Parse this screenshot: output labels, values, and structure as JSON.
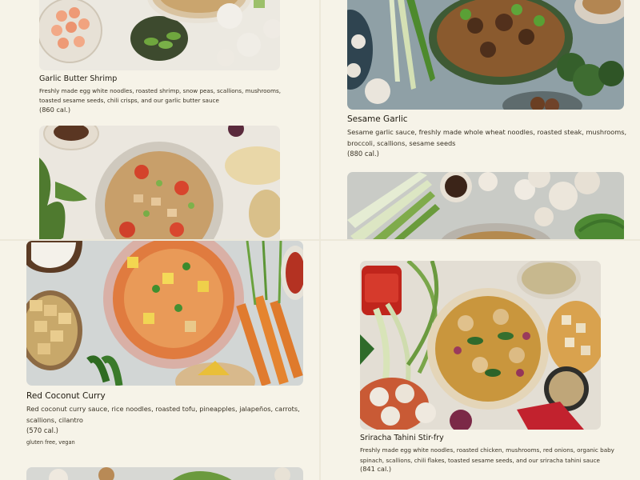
{
  "menu": {
    "items": [
      {
        "name": "Garlic Butter Shrimp",
        "description": "Freshly made egg white noodles, roasted shrimp, snow peas, scallions, mushrooms, toasted sesame seeds, chili crisps, and our garlic butter sauce",
        "calories": "(860 cal.)",
        "photo": "garlic-butter-shrimp-photo"
      },
      {
        "name": "Sesame Garlic",
        "description": "Sesame garlic sauce, freshly made whole wheat noodles, roasted steak, mushrooms, broccoli, scallions, sesame seeds",
        "calories": "(880 cal.)",
        "photo": "sesame-garlic-photo"
      },
      {
        "name": "Red Coconut Curry",
        "description": "Red coconut curry sauce, rice noodles, roasted tofu, pineapples, jalapeños, carrots, scallions, cilantro",
        "calories": "(570 cal.)",
        "tags": "gluten free, vegan",
        "photo": "red-coconut-curry-photo"
      },
      {
        "name": "Sriracha Tahini Stir-fry",
        "description": "Freshly made egg white noodles, roasted chicken, mushrooms, red onions, organic baby spinach, scallions, chili flakes, toasted sesame seeds, and our sriracha tahini sauce",
        "calories": "(841 cal.)",
        "photo": "sriracha-tahini-photo"
      }
    ]
  },
  "colors": {
    "background": "#f6f3e8",
    "text": "#1f1a10"
  }
}
